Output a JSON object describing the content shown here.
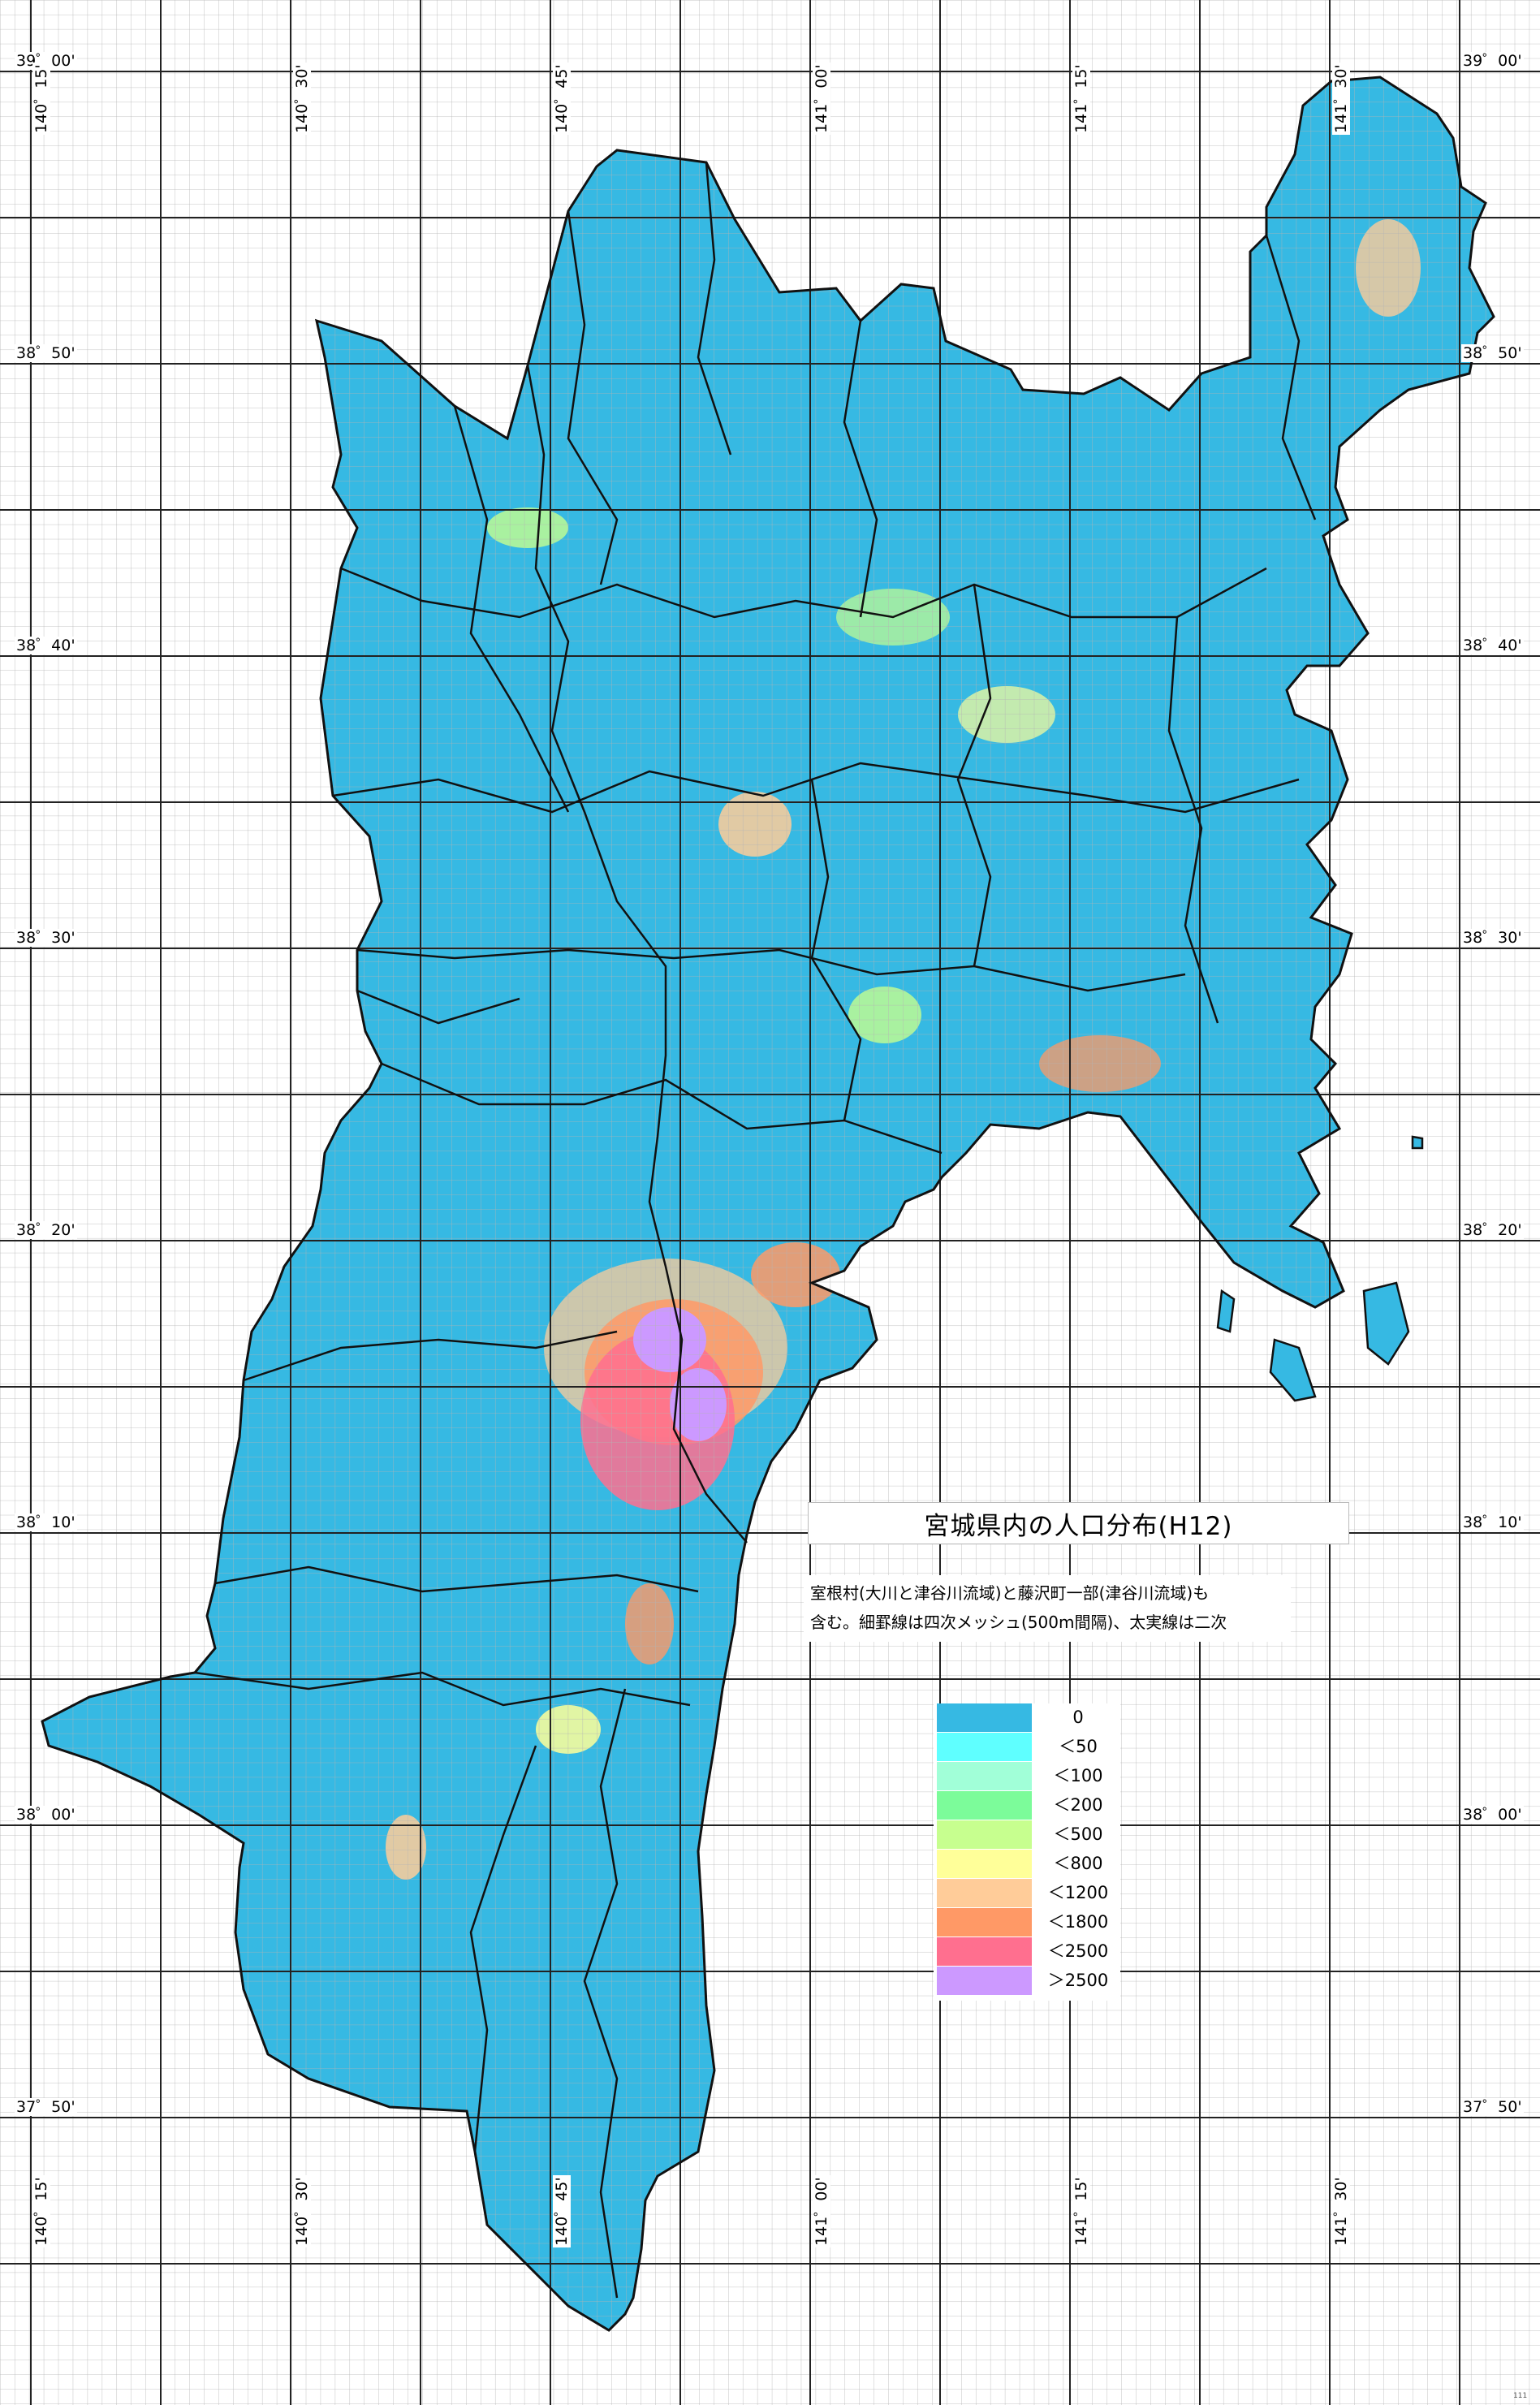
{
  "title": "宮城県内の人口分布(H12)",
  "note_lines": [
    "室根村(大川と津谷川流域)と藤沢町一部(津谷川流域)も",
    "含む。細罫線は四次メッシュ(500m間隔)、太実線は二次"
  ],
  "legend": [
    {
      "label": "0",
      "color": "#36b9e3"
    },
    {
      "label": "＜50",
      "color": "#5fffff"
    },
    {
      "label": "＜100",
      "color": "#a1ffd8"
    },
    {
      "label": "＜200",
      "color": "#7cfc9a"
    },
    {
      "label": "＜500",
      "color": "#c7ff8f"
    },
    {
      "label": "＜800",
      "color": "#ffff99"
    },
    {
      "label": "＜1200",
      "color": "#ffcc99"
    },
    {
      "label": "＜1800",
      "color": "#ff9966"
    },
    {
      "label": "＜2500",
      "color": "#ff6f8f"
    },
    {
      "label": "＞2500",
      "color": "#cc99ff"
    }
  ],
  "latitude_labels": [
    "39゜00'",
    "38゜50'",
    "38゜40'",
    "38゜30'",
    "38゜20'",
    "38゜10'",
    "38゜00'",
    "37゜50'"
  ],
  "longitude_labels": [
    "140゜15'",
    "140゜30'",
    "140゜45'",
    "141゜00'",
    "141゜15'",
    "141゜30'"
  ],
  "corner_mark": "111",
  "colors": {
    "land": "#36b9e3",
    "sea": "#ffffff",
    "fine_grid": "#b4b4b4",
    "coarse_grid": "#222222",
    "boundary": "#111111"
  }
}
